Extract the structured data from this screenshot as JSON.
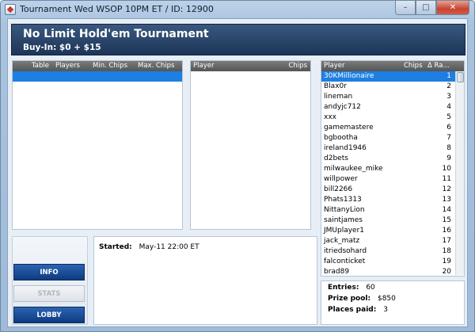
{
  "window": {
    "title": "Tournament Wed WSOP 10PM ET / ID: 12900",
    "controls": {
      "minimize": "–",
      "maximize": "□",
      "close": "✕"
    }
  },
  "header": {
    "title": "No Limit Hold'em Tournament",
    "buyin": "Buy-In: $0 + $15"
  },
  "tables_panel": {
    "columns": [
      "Table",
      "Players",
      "Min. Chips",
      "Max. Chips"
    ]
  },
  "table_players_panel": {
    "columns": [
      "Player",
      "Chips"
    ]
  },
  "players_panel": {
    "columns": {
      "player": "Player",
      "chips": "Chips",
      "rank": "Δ Ra..."
    },
    "rows": [
      {
        "name": "30KMillionaire",
        "rank": "1"
      },
      {
        "name": "Blax0r",
        "rank": "2"
      },
      {
        "name": "lineman",
        "rank": "3"
      },
      {
        "name": "andyjc712",
        "rank": "4"
      },
      {
        "name": "xxx",
        "rank": "5"
      },
      {
        "name": "gamemastere",
        "rank": "6"
      },
      {
        "name": "bgbootha",
        "rank": "7"
      },
      {
        "name": "ireland1946",
        "rank": "8"
      },
      {
        "name": "d2bets",
        "rank": "9"
      },
      {
        "name": "milwaukee_mike",
        "rank": "10"
      },
      {
        "name": "willpower",
        "rank": "11"
      },
      {
        "name": "bill2266",
        "rank": "12"
      },
      {
        "name": "Phats1313",
        "rank": "13"
      },
      {
        "name": "NittanyLion",
        "rank": "14"
      },
      {
        "name": "saintjames",
        "rank": "15"
      },
      {
        "name": "JMUplayer1",
        "rank": "16"
      },
      {
        "name": "jack_matz",
        "rank": "17"
      },
      {
        "name": "itriedsohard",
        "rank": "18"
      },
      {
        "name": "falconticket",
        "rank": "19"
      },
      {
        "name": "brad89",
        "rank": "20"
      }
    ]
  },
  "buttons": {
    "info": "INFO",
    "stats": "STATS",
    "lobby": "LOBBY"
  },
  "status": {
    "started_label": "Started:",
    "started_value": "May-11 22:00 ET"
  },
  "summary": {
    "entries_label": "Entries:",
    "entries_value": "60",
    "prize_label": "Prize pool:",
    "prize_value": "$850",
    "places_label": "Places paid:",
    "places_value": "3"
  }
}
